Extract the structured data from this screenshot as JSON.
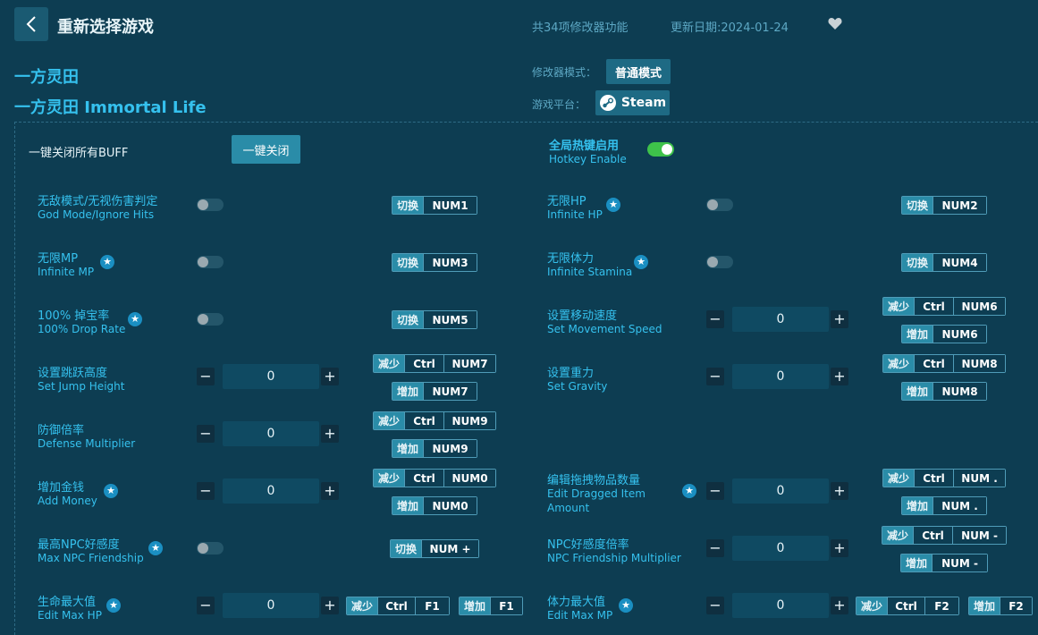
{
  "header": {
    "title": "重新选择游戏",
    "feature_count": "共34项修改器功能",
    "update_date": "更新日期:2024-01-24"
  },
  "game": {
    "name_cn": "一方灵田",
    "name_en": "一方灵田 Immortal Life"
  },
  "meta": {
    "mode_label": "修改器模式：",
    "mode_value": "普通模式",
    "platform_label": "游戏平台：",
    "platform_value": "Steam"
  },
  "controls": {
    "close_all_label": "一键关闭所有BUFF",
    "close_all_button": "一键关闭",
    "hotkey_cn": "全局热键启用",
    "hotkey_en": "Hotkey Enable",
    "hotkey_enabled": true
  },
  "labels": {
    "toggle": "切换",
    "decrease": "减少",
    "increase": "增加",
    "minus": "−",
    "plus": "+",
    "star": "★"
  },
  "features": [
    {
      "cn": "无敌模式/无视伤害判定",
      "en": "God Mode/Ignore Hits",
      "value": "",
      "keys": {
        "toggle": [
          "NUM1"
        ]
      }
    },
    {
      "cn": "无限HP",
      "en": "Infinite HP",
      "value": "",
      "keys": {
        "toggle": [
          "NUM2"
        ]
      }
    },
    {
      "cn": "无限MP",
      "en": "Infinite MP",
      "value": "",
      "keys": {
        "toggle": [
          "NUM3"
        ]
      }
    },
    {
      "cn": "无限体力",
      "en": "Infinite Stamina",
      "value": "",
      "keys": {
        "toggle": [
          "NUM4"
        ]
      }
    },
    {
      "cn": "100% 掉宝率",
      "en": "100% Drop Rate",
      "value": "",
      "keys": {
        "toggle": [
          "NUM5"
        ]
      }
    },
    {
      "cn": "设置移动速度",
      "en": "Set Movement Speed",
      "value": "0",
      "keys": {
        "dec": [
          "Ctrl",
          "NUM6"
        ],
        "inc": [
          "NUM6"
        ]
      }
    },
    {
      "cn": "设置跳跃高度",
      "en": "Set Jump Height",
      "value": "0",
      "keys": {
        "dec": [
          "Ctrl",
          "NUM7"
        ],
        "inc": [
          "NUM7"
        ]
      }
    },
    {
      "cn": "设置重力",
      "en": "Set Gravity",
      "value": "0",
      "keys": {
        "dec": [
          "Ctrl",
          "NUM8"
        ],
        "inc": [
          "NUM8"
        ]
      }
    },
    {
      "cn": "防御倍率",
      "en": "Defense Multiplier",
      "value": "0",
      "keys": {
        "dec": [
          "Ctrl",
          "NUM9"
        ],
        "inc": [
          "NUM9"
        ]
      }
    },
    {
      "cn": "增加金钱",
      "en": "Add Money",
      "value": "0",
      "keys": {
        "dec": [
          "Ctrl",
          "NUM0"
        ],
        "inc": [
          "NUM0"
        ]
      }
    },
    {
      "cn": "编辑拖拽物品数量",
      "en": "Edit Dragged Item",
      "en2": "Amount",
      "value": "0",
      "keys": {
        "dec": [
          "Ctrl",
          "NUM ."
        ],
        "inc": [
          "NUM ."
        ]
      }
    },
    {
      "cn": "最高NPC好感度",
      "en": "Max NPC Friendship",
      "value": "",
      "keys": {
        "toggle": [
          "NUM +"
        ]
      }
    },
    {
      "cn": "NPC好感度倍率",
      "en": "NPC Friendship Multiplier",
      "value": "0",
      "keys": {
        "dec": [
          "Ctrl",
          "NUM -"
        ],
        "inc": [
          "NUM -"
        ]
      }
    },
    {
      "cn": "生命最大值",
      "en": "Edit Max HP",
      "value": "0",
      "keys": {
        "dec": [
          "Ctrl",
          "F1"
        ],
        "inc": [
          "F1"
        ]
      }
    },
    {
      "cn": "体力最大值",
      "en": "Edit Max MP",
      "value": "0",
      "keys": {
        "dec": [
          "Ctrl",
          "F2"
        ],
        "inc": [
          "F2"
        ]
      }
    }
  ]
}
